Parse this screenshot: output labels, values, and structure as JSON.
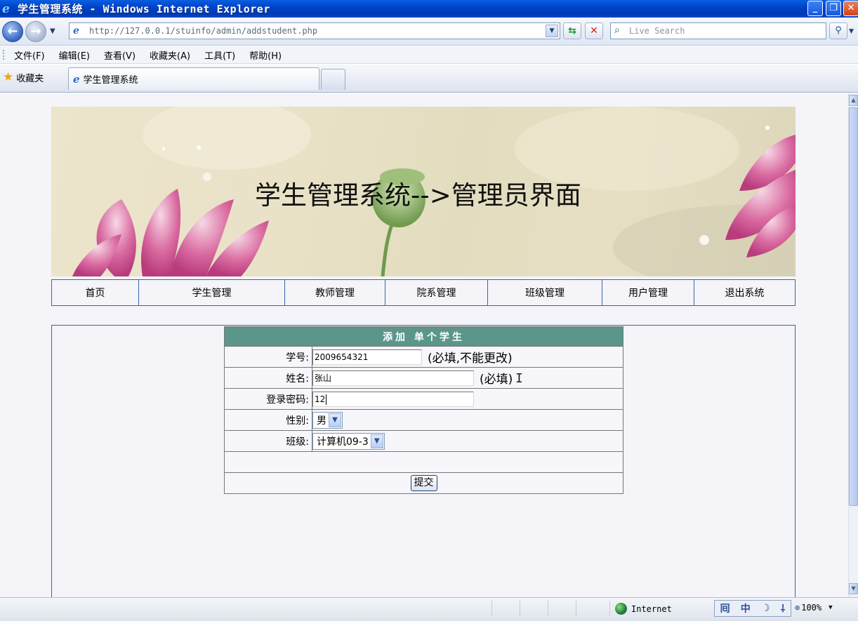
{
  "window": {
    "title": "学生管理系统 - Windows Internet Explorer",
    "minimize": "_",
    "maximize": "❐",
    "close": "✕"
  },
  "addressbar": {
    "url": "http://127.0.0.1/stuinfo/admin/addstudent.php",
    "search_placeholder": "Live Search"
  },
  "menubar": {
    "items": [
      "文件(F)",
      "编辑(E)",
      "查看(V)",
      "收藏夹(A)",
      "工具(T)",
      "帮助(H)"
    ]
  },
  "tabbar": {
    "favorites_label": "收藏夹",
    "active_tab": "学生管理系统"
  },
  "banner": {
    "title": "学生管理系统-->管理员界面"
  },
  "nav": {
    "items": [
      "首页",
      "学生管理",
      "教师管理",
      "院系管理",
      "班级管理",
      "用户管理",
      "退出系统"
    ]
  },
  "form": {
    "heading": "添加 单个学生",
    "rows": {
      "student_id": {
        "label": "学号:",
        "value": "2009654321",
        "hint": "(必填,不能更改)"
      },
      "name": {
        "label": "姓名:",
        "value": "张山",
        "hint": "(必填)"
      },
      "password": {
        "label": "登录密码:",
        "value": "12"
      },
      "gender": {
        "label": "性别:",
        "value": "男"
      },
      "class": {
        "label": "班级:",
        "value": "计算机09-3"
      }
    },
    "submit_label": "提交"
  },
  "statusbar": {
    "zone": "Internet",
    "ime": [
      "囘",
      "中",
      "☽",
      "⸸"
    ],
    "zoom": "100%"
  },
  "colors": {
    "form_header": "#5a968a",
    "border_blue": "#3a66a8",
    "titlebar": "#0042c8"
  }
}
